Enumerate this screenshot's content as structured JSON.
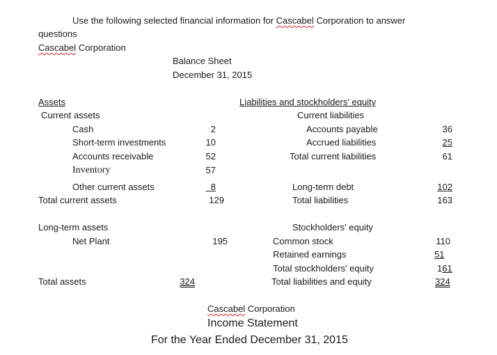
{
  "intro": {
    "line1_prefix": "Use the following selected financial information for ",
    "line1_company": "Cascabel",
    "line1_suffix": " Corporation to answer",
    "line2": "questions"
  },
  "company": {
    "name_a": "Cascabel",
    "name_b": " Corporation"
  },
  "balance_sheet": {
    "title": "Balance Sheet",
    "date": "December 31, 2015",
    "assets": {
      "heading": "Assets",
      "current_heading": "Current assets",
      "items": [
        {
          "label": "Cash",
          "value": "2"
        },
        {
          "label": "Short-term investments",
          "value": "10"
        },
        {
          "label": "Accounts receivable",
          "value": "52"
        },
        {
          "label": "Inventory",
          "value": "57"
        },
        {
          "label": "Other current assets",
          "value": "8"
        }
      ],
      "total_current": {
        "label": "Total current assets",
        "value": "129"
      },
      "long_term_heading": "Long-term assets",
      "net_plant": {
        "label": "Net Plant",
        "value": "195"
      },
      "total": {
        "label": "Total assets",
        "value": "324"
      }
    },
    "liabilities": {
      "heading": "Liabilities and stockholders' equity",
      "current_heading": "Current liabilities",
      "items": [
        {
          "label": "Accounts payable",
          "value": "36"
        },
        {
          "label": "Accrued liabilities",
          "value": "25"
        }
      ],
      "total_current": {
        "label": "Total current liabilities",
        "value": "61"
      },
      "long_term_debt": {
        "label": "Long-term debt",
        "value": "102"
      },
      "total": {
        "label": "Total liabilities",
        "value": "163"
      }
    },
    "equity": {
      "heading": "Stockholders' equity",
      "common_stock": {
        "label": "Common stock",
        "value": "110"
      },
      "retained_earnings": {
        "label": "Retained earnings",
        "value": "51"
      },
      "total": {
        "label": "Total stockholders' equity",
        "value_a": "1",
        "value_b": "61"
      },
      "total_liab_equity": {
        "label": "Total liabilities and equity",
        "value": "324"
      }
    }
  },
  "income_statement": {
    "company_a": "Cascabel",
    "company_b": " Corporation",
    "title": "Income Statement",
    "period": "For the Year Ended December 31, 2015"
  }
}
